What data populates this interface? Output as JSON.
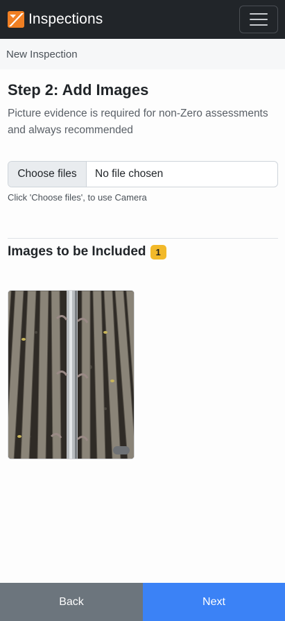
{
  "app": {
    "title": "Inspections",
    "brand_color": "#f07f23"
  },
  "breadcrumb": {
    "label": "New Inspection"
  },
  "step": {
    "title": "Step 2: Add Images",
    "description": "Picture evidence is required for non-Zero assessments and always recommended"
  },
  "file_input": {
    "button_label": "Choose files",
    "status": "No file chosen",
    "help": "Click 'Choose files', to use Camera"
  },
  "images": {
    "title": "Images to be Included",
    "count": "1",
    "badge_color": "#f2b92a",
    "items": [
      {
        "alt": "Railway track photo"
      }
    ]
  },
  "footer": {
    "back_label": "Back",
    "next_label": "Next",
    "back_color": "#6c757d",
    "next_color": "#3b82f6"
  },
  "icons": {
    "brand": "app-logo-icon",
    "menu": "hamburger-menu-icon",
    "refresh": "refresh-icon"
  }
}
